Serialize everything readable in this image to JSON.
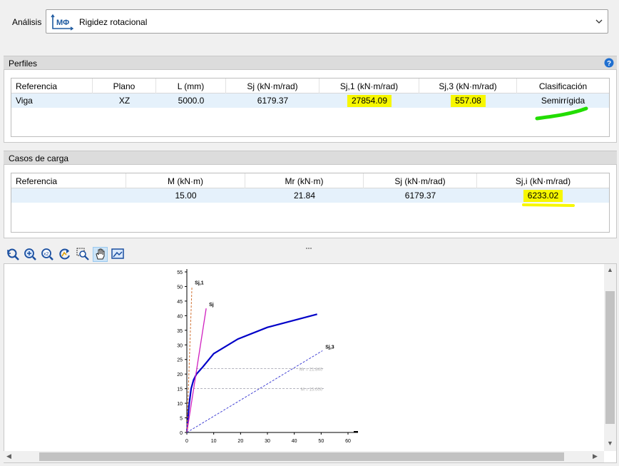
{
  "analysis": {
    "label": "Análisis",
    "value": "Rigidez rotacional",
    "icon": "moment-rotation-icon",
    "icon_text": "MΦ"
  },
  "profiles": {
    "title": "Perfiles",
    "columns": [
      "Referencia",
      "Plano",
      "L (mm)",
      "Sj (kN·m/rad)",
      "Sj,1 (kN·m/rad)",
      "Sj,3 (kN·m/rad)",
      "Clasificación"
    ],
    "row": {
      "referencia": "Viga",
      "plano": "XZ",
      "l": "5000.0",
      "sj": "6179.37",
      "sj1": "27854.09",
      "sj3": "557.08",
      "clasificacion": "Semirrígida"
    }
  },
  "load_cases": {
    "title": "Casos de carga",
    "columns": [
      "Referencia",
      "M (kN·m)",
      "Mr (kN·m)",
      "Sj (kN·m/rad)",
      "Sj,i (kN·m/rad)"
    ],
    "row": {
      "referencia": "",
      "m": "15.00",
      "mr": "21.84",
      "sj": "6179.37",
      "sji": "6233.02"
    }
  },
  "toolbar": {
    "icons": [
      "zoom-reset-icon",
      "zoom-fit-icon",
      "zoom-x2-icon",
      "refresh-icon",
      "zoom-window-icon",
      "pan-hand-icon",
      "export-image-icon"
    ]
  },
  "colors": {
    "highlight": "#f7f700",
    "marker_green": "#22dd00",
    "curve": "#0000c8",
    "sj_line": "#d020c0",
    "sj1_line": "#d07030",
    "sj3_line": "#3030d0"
  },
  "chart_data": {
    "type": "line",
    "xlim": [
      0,
      60
    ],
    "ylim": [
      0,
      55
    ],
    "xticks": [
      0,
      10,
      20,
      30,
      40,
      50,
      60
    ],
    "yticks": [
      0,
      5,
      10,
      15,
      20,
      25,
      30,
      35,
      40,
      45,
      50,
      55
    ],
    "series": [
      {
        "name": "",
        "style": "solid",
        "x": [
          0,
          0.4,
          0.9,
          1.6,
          2.5,
          3.6,
          6.0,
          10.0,
          19.0,
          30.0,
          48.5
        ],
        "y": [
          0,
          5,
          10,
          15,
          18,
          20,
          22.5,
          27,
          32,
          36,
          40.5
        ]
      },
      {
        "name": "Sj",
        "style": "solid",
        "x": [
          0,
          7.2
        ],
        "y": [
          0,
          42.5
        ]
      },
      {
        "name": "Sj,1",
        "style": "dashed",
        "x": [
          0,
          1.9
        ],
        "y": [
          0,
          50
        ]
      },
      {
        "name": "Sj,3",
        "style": "dashed",
        "x": [
          0,
          50.5
        ],
        "y": [
          0,
          28
        ]
      }
    ],
    "reference_lines": [
      {
        "label": "Mr = 21.840",
        "y": 21.84,
        "x_start": 3.5,
        "x_end": 51
      },
      {
        "label": "M = 15.000",
        "y": 15.0,
        "x_start": 2.4,
        "x_end": 51
      }
    ]
  }
}
